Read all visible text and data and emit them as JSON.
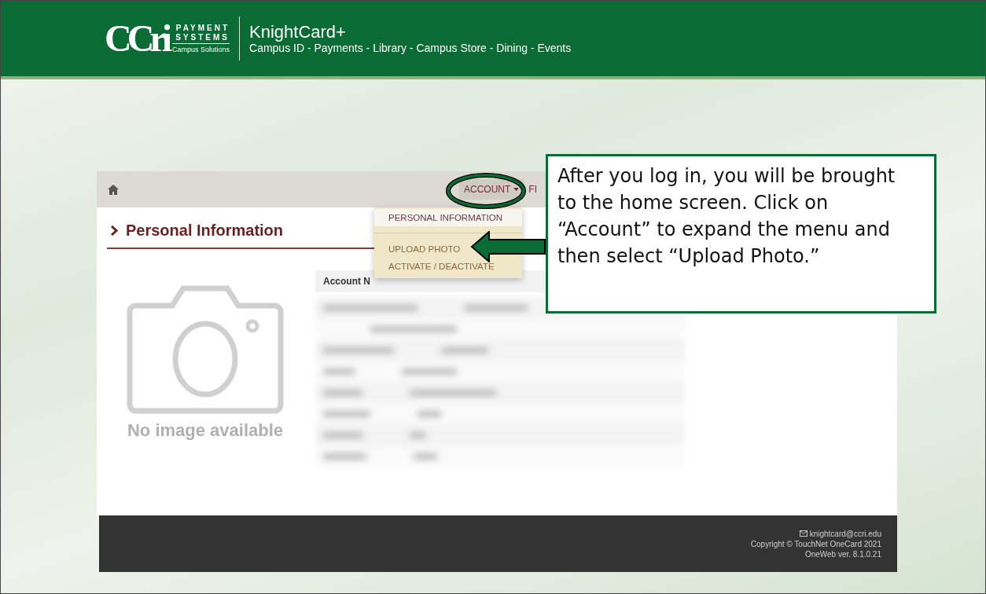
{
  "header": {
    "logo_text": "CCri",
    "logo_line1": "PAYMENT",
    "logo_line2": "SYSTEMS",
    "logo_sub": "Campus Solutions",
    "title": "KnightCard+",
    "tagline": "Campus ID - Payments - Library - Campus Store - Dining - Events"
  },
  "nav": {
    "items": [
      {
        "label": "ACCOUNT",
        "kind": "dropdown",
        "expanded": true
      },
      {
        "label": "FI",
        "kind": "link",
        "expanded": false
      }
    ]
  },
  "dropdown": {
    "items": [
      {
        "label": "PERSONAL INFORMATION",
        "selected": true
      },
      {
        "label": "UPLOAD PHOTO",
        "selected": false
      },
      {
        "label": "ACTIVATE / DEACTIVATE",
        "selected": false
      }
    ]
  },
  "section": {
    "title": "Personal Information",
    "no_image": "No image available",
    "table_header": "Account N"
  },
  "callout": {
    "text": "After you log in, you will be brought to the home screen. Click on “Account” to expand the menu and then select “Upload Photo.”"
  },
  "footer": {
    "email": "knightcard@ccri.edu",
    "copyright": "Copyright © TouchNet OneCard 2021",
    "version": "OneWeb ver. 8.1.0.21"
  }
}
